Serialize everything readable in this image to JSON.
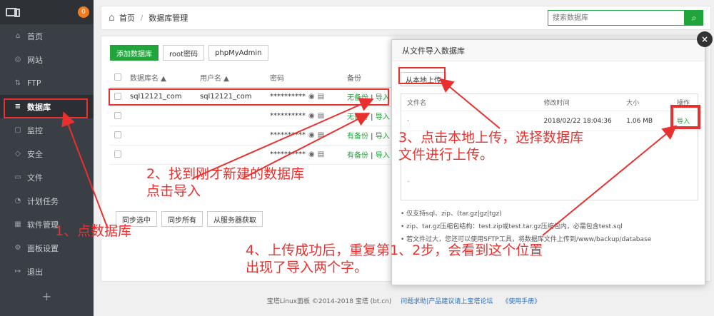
{
  "sidebar": {
    "badge": "0",
    "items": [
      {
        "label": "首页",
        "icon": "home-icon",
        "glyph": "⌂"
      },
      {
        "label": "网站",
        "icon": "globe-icon",
        "glyph": "◎"
      },
      {
        "label": "FTP",
        "icon": "ftp-icon",
        "glyph": "⇅"
      },
      {
        "label": "数据库",
        "icon": "database-icon",
        "glyph": "≡"
      },
      {
        "label": "监控",
        "icon": "monitor-icon",
        "glyph": "▢"
      },
      {
        "label": "安全",
        "icon": "shield-icon",
        "glyph": "◇"
      },
      {
        "label": "文件",
        "icon": "folder-icon",
        "glyph": "▭"
      },
      {
        "label": "计划任务",
        "icon": "clock-icon",
        "glyph": "◔"
      },
      {
        "label": "软件管理",
        "icon": "apps-icon",
        "glyph": "▦"
      },
      {
        "label": "面板设置",
        "icon": "gear-icon",
        "glyph": "⚙"
      },
      {
        "label": "退出",
        "icon": "logout-icon",
        "glyph": "↦"
      }
    ],
    "active_index": 3,
    "plus": "+"
  },
  "breadcrumb": {
    "home": "首页",
    "separator": "/",
    "current": "数据库管理"
  },
  "search": {
    "placeholder": "搜索数据库"
  },
  "toolbar": {
    "add": "添加数据库",
    "root_pwd": "root密码",
    "phpmyadmin": "phpMyAdmin"
  },
  "table": {
    "headers": [
      "数据库名 ▲",
      "用户名 ▲",
      "密码",
      "备份"
    ],
    "rows": [
      {
        "name": "sql12121_com",
        "user": "sql12121_com",
        "password": "**********",
        "backup": "无备份",
        "action": "导入"
      },
      {
        "name": "",
        "user": "",
        "password": "**********",
        "backup": "无备份",
        "action": "导入"
      },
      {
        "name": "",
        "user": "",
        "password": "**********",
        "backup": "有备份",
        "action": "导入"
      },
      {
        "name": "",
        "user": "",
        "password": "**********",
        "backup": "有备份",
        "action": "导入"
      }
    ],
    "bottom_buttons": [
      "同步选中",
      "同步所有",
      "从服务器获取"
    ]
  },
  "footer": {
    "copyright": "宝塔Linux面板 ©2014-2018 宝塔 (bt.cn)",
    "links": [
      "问题求助|产品建议请上宝塔论坛",
      "《使用手册》"
    ]
  },
  "modal": {
    "title": "从文件导入数据库",
    "upload": "从本地上传",
    "columns": [
      "文件名",
      "修改时间",
      "大小",
      "操作"
    ],
    "file": {
      "name": "·",
      "modified": "2018/02/22 18:04:36",
      "size": "1.06 MB",
      "action": "导入"
    },
    "extra_dot": "·",
    "notes": [
      "仅支持sql、zip、(tar.gz|gz|tgz)",
      "zip、tar.gz压缩包结构：test.zip或test.tar.gz压缩包内，必需包含test.sql",
      "若文件过大，您还可以使用SFTP工具，将数据库文件上传到/www/backup/database"
    ],
    "close": "×"
  },
  "annotations": {
    "step1": "1、点数据库",
    "step2_line1": "2、找到刚才新建的数据库",
    "step2_line2": "点击导入",
    "step3_line1": "3、点击本地上传，选择数据库",
    "step3_line2": "文件进行上传。",
    "step4_line1": "4、上传成功后，重复第1、2步，会看到这个位置",
    "step4_line2": "出现了导入两个字。",
    "color": "#e8312e"
  }
}
